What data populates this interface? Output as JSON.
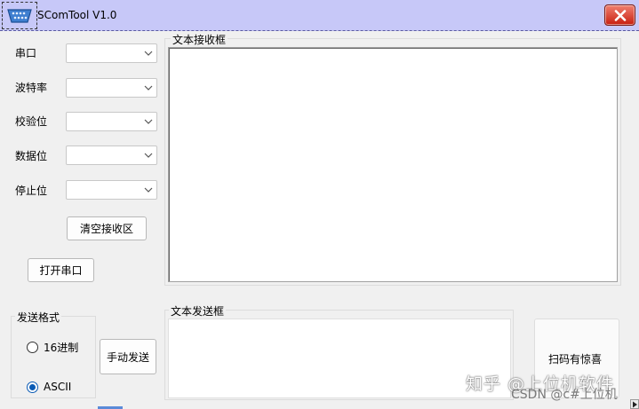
{
  "window": {
    "title": "SComTool V1.0",
    "icon": "serial-port-icon",
    "close_icon": "close-icon"
  },
  "settings": {
    "port_label": "串口",
    "baud_label": "波特率",
    "parity_label": "校验位",
    "databits_label": "数据位",
    "stopbits_label": "停止位",
    "port_value": "",
    "baud_value": "",
    "parity_value": "",
    "databits_value": "",
    "stopbits_value": ""
  },
  "buttons": {
    "clear_receive": "清空接收区",
    "open_port": "打开串口",
    "manual_send": "手动发送",
    "scan_qr": "扫码有惊喜"
  },
  "receive": {
    "title": "文本接收框",
    "content": ""
  },
  "send": {
    "title": "文本发送框",
    "content": ""
  },
  "send_format": {
    "title": "发送格式",
    "options": [
      {
        "label": "16进制",
        "checked": false
      },
      {
        "label": "ASCII",
        "checked": true
      }
    ]
  },
  "watermark": {
    "main": "知乎 @上位机软件",
    "sub": "CSDN @c#上位机"
  },
  "colors": {
    "titlebar": "#c7c8f8",
    "close": "#c81f10",
    "radio_accent": "#0a5bb5"
  }
}
